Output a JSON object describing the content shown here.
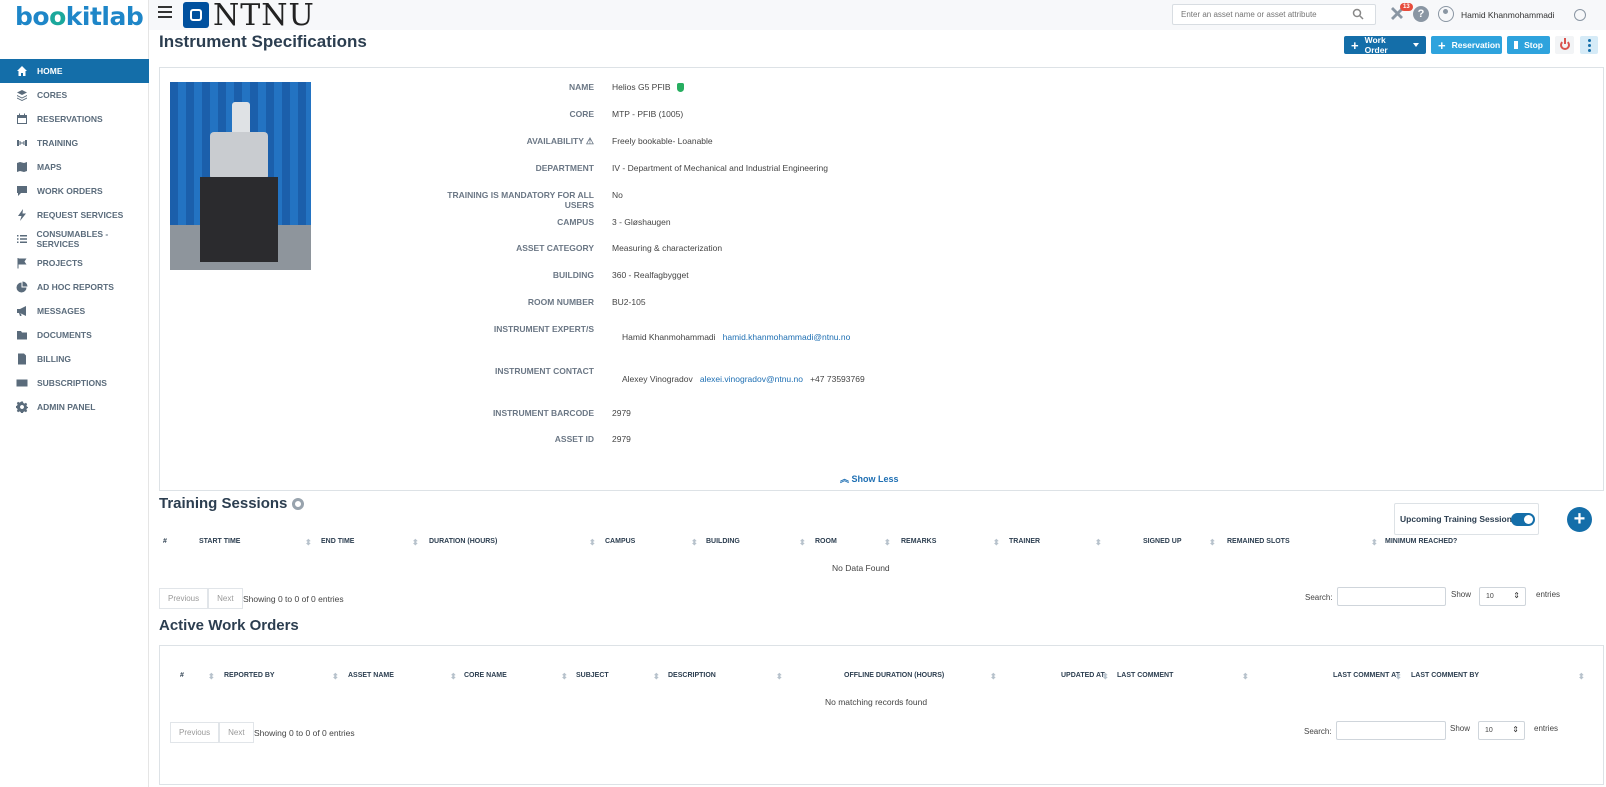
{
  "logo": {
    "text": "bookitlab"
  },
  "sidebar": {
    "items": [
      {
        "label": "HOME",
        "icon": "home-icon",
        "active": true
      },
      {
        "label": "CORES",
        "icon": "layers-icon"
      },
      {
        "label": "RESERVATIONS",
        "icon": "calendar-icon"
      },
      {
        "label": "TRAINING",
        "icon": "dumbbell-icon"
      },
      {
        "label": "MAPS",
        "icon": "map-icon"
      },
      {
        "label": "WORK ORDERS",
        "icon": "comment-icon"
      },
      {
        "label": "REQUEST SERVICES",
        "icon": "bolt-icon"
      },
      {
        "label": "CONSUMABLES - SERVICES",
        "icon": "list-icon"
      },
      {
        "label": "PROJECTS",
        "icon": "flag-icon"
      },
      {
        "label": "AD HOC REPORTS",
        "icon": "pie-chart-icon"
      },
      {
        "label": "MESSAGES",
        "icon": "bullhorn-icon"
      },
      {
        "label": "DOCUMENTS",
        "icon": "folder-icon"
      },
      {
        "label": "BILLING",
        "icon": "invoice-icon"
      },
      {
        "label": "SUBSCRIPTIONS",
        "icon": "card-icon"
      },
      {
        "label": "ADMIN PANEL",
        "icon": "gear-icon"
      }
    ]
  },
  "topbar": {
    "brand": "NTNU",
    "search_placeholder": "Enter an asset name or asset attribute",
    "notification_count": "13",
    "user_name": "Hamid Khanmohammadi"
  },
  "page": {
    "title": "Instrument Specifications",
    "buttons": {
      "work_order": "Work Order",
      "reservation": "Reservation",
      "stop": "Stop"
    }
  },
  "specs": [
    {
      "label": "NAME",
      "value": "Helios G5 PFIB"
    },
    {
      "label": "CORE",
      "value": "MTP - PFIB (1005)"
    },
    {
      "label": "AVAILABILITY",
      "value": "Freely bookable- Loanable"
    },
    {
      "label": "DEPARTMENT",
      "value": "IV - Department of Mechanical and Industrial Engineering"
    },
    {
      "label": "TRAINING IS MANDATORY FOR ALL USERS",
      "value": "No"
    },
    {
      "label": "CAMPUS",
      "value": "3 - Gløshaugen"
    },
    {
      "label": "ASSET CATEGORY",
      "value": "Measuring & characterization"
    },
    {
      "label": "BUILDING",
      "value": "360 - Realfagbygget"
    },
    {
      "label": "ROOM NUMBER",
      "value": "BU2-105"
    },
    {
      "label": "INSTRUMENT EXPERT/S",
      "name": "Hamid Khanmohammadi",
      "email": "hamid.khanmohammadi@ntnu.no"
    },
    {
      "label": "INSTRUMENT CONTACT",
      "name": "Alexey Vinogradov",
      "email": "alexei.vinogradov@ntnu.no",
      "phone": "+47 73593769"
    },
    {
      "label": "INSTRUMENT BARCODE",
      "value": "2979"
    },
    {
      "label": "ASSET ID",
      "value": "2979"
    }
  ],
  "show_less": "Show Less",
  "training": {
    "title": "Training Sessions",
    "toggle_label": "Upcoming Training Sessions",
    "columns": [
      "#",
      "START TIME",
      "END TIME",
      "DURATION (HOURS)",
      "CAMPUS",
      "BUILDING",
      "ROOM",
      "REMARKS",
      "TRAINER",
      "SIGNED UP",
      "REMAINED SLOTS",
      "MINIMUM REACHED?"
    ],
    "empty": "No Data Found",
    "info": "Showing 0 to 0 of 0 entries",
    "prev": "Previous",
    "next": "Next",
    "search_label": "Search:",
    "show_label": "Show",
    "page_size": "10",
    "entries_label": "entries"
  },
  "work_orders": {
    "title": "Active Work Orders",
    "columns": [
      "#",
      "REPORTED BY",
      "ASSET NAME",
      "CORE NAME",
      "SUBJECT",
      "DESCRIPTION",
      "OFFLINE DURATION (HOURS)",
      "UPDATED AT",
      "LAST COMMENT",
      "LAST COMMENT AT",
      "LAST COMMENT BY"
    ],
    "empty": "No matching records found",
    "info": "Showing 0 to 0 of 0 entries",
    "prev": "Previous",
    "next": "Next",
    "search_label": "Search:",
    "show_label": "Show",
    "page_size": "10",
    "entries_label": "entries"
  }
}
